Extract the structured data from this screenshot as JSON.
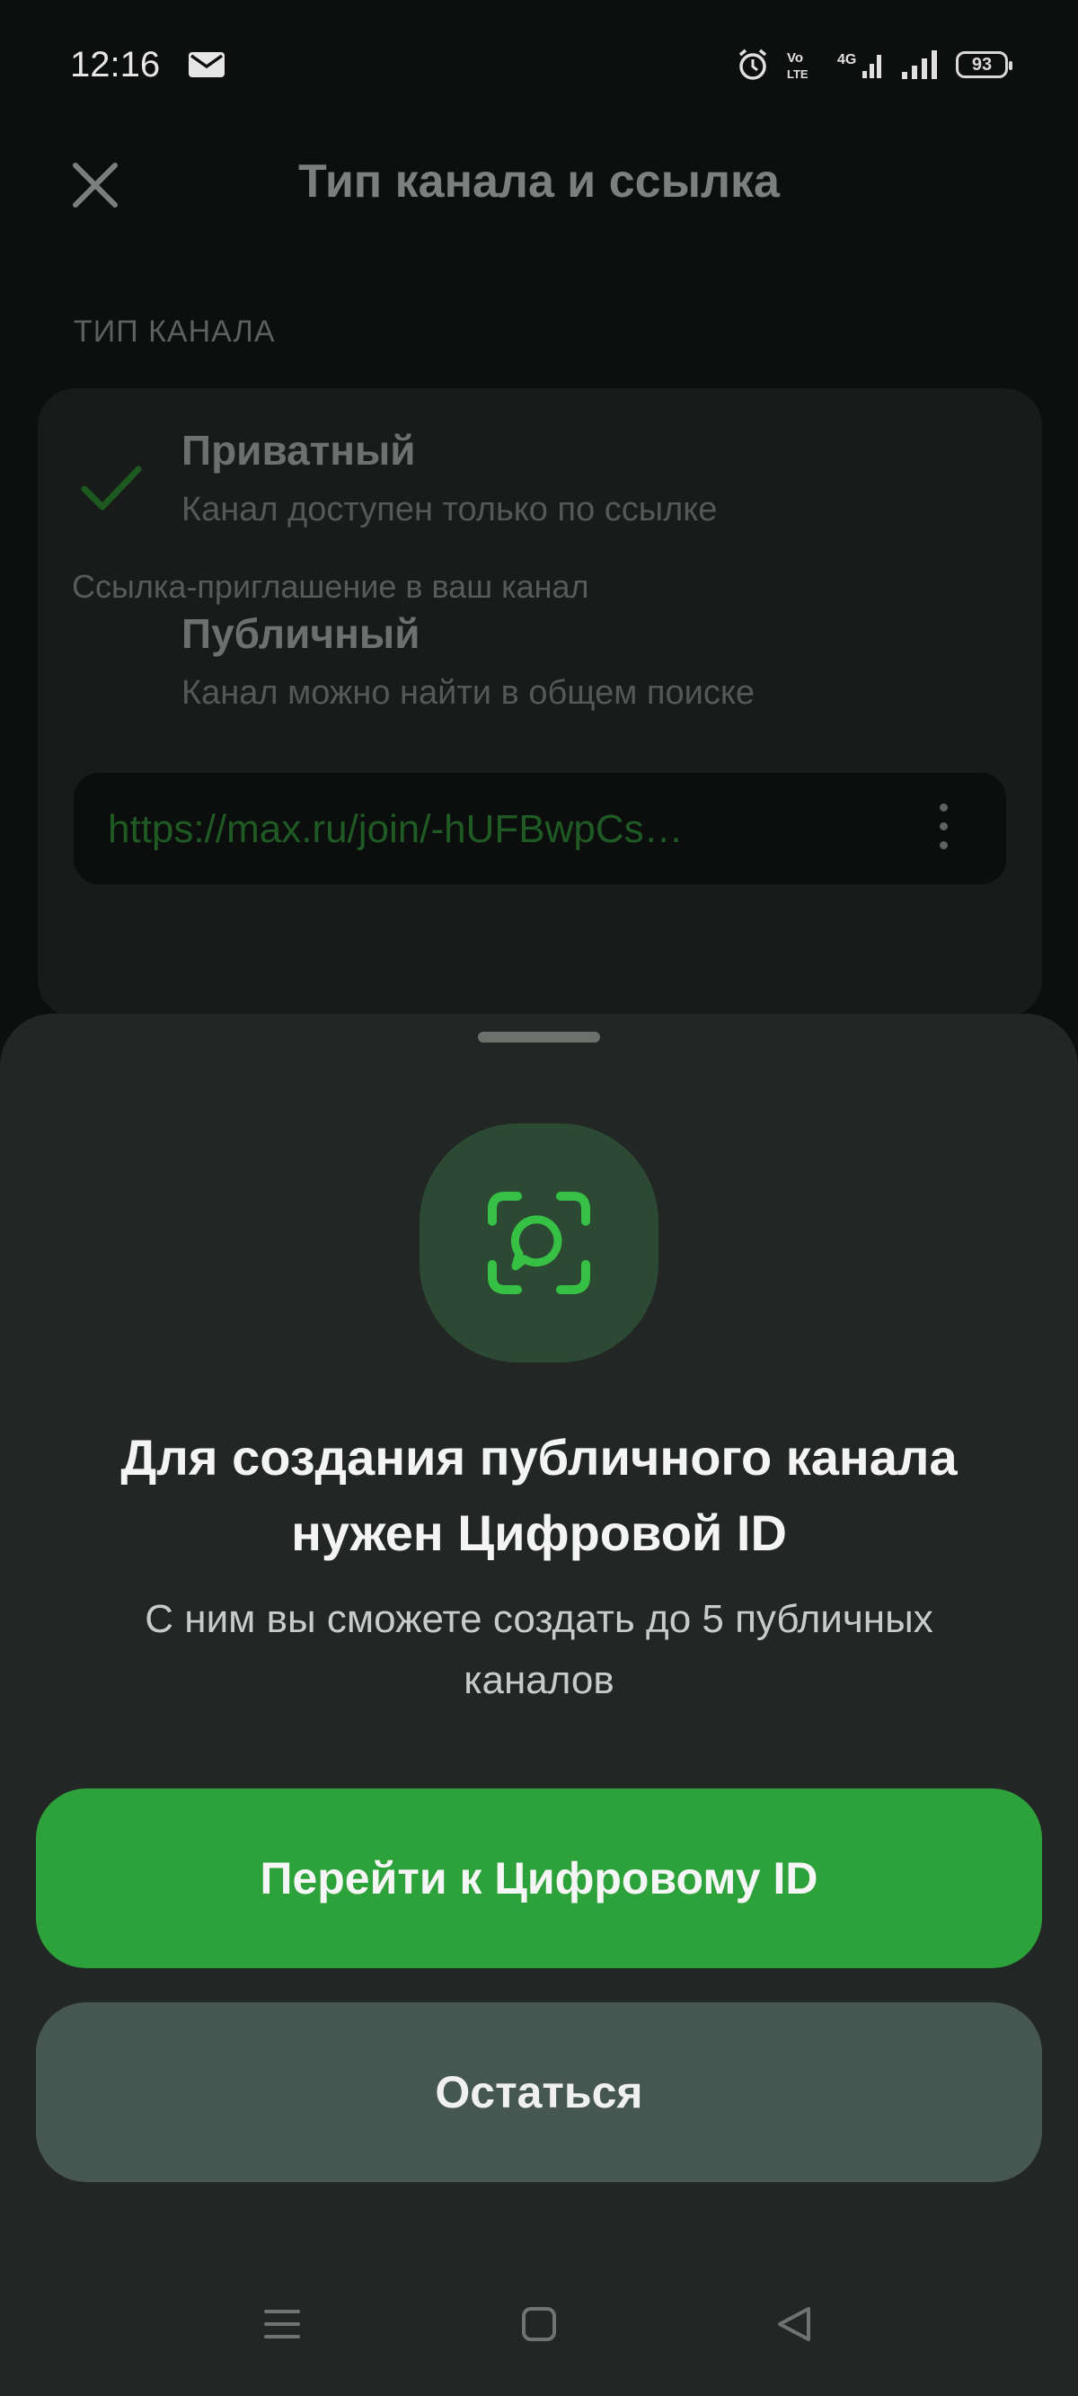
{
  "status_bar": {
    "time": "12:16",
    "battery": "93",
    "icons": [
      "mail-icon",
      "alarm-icon",
      "volte-icon",
      "4g-signal-icon",
      "signal-icon",
      "battery-icon"
    ]
  },
  "header": {
    "title": "Тип канала и ссылка",
    "close_icon": "close-icon"
  },
  "channel_type": {
    "section_label": "ТИП КАНАЛА",
    "options": [
      {
        "title": "Приватный",
        "description": "Канал доступен только по ссылке",
        "selected": true
      },
      {
        "title": "Публичный",
        "description": "Канал можно найти в общем поиске",
        "selected": false
      }
    ],
    "link": "https://max.ru/join/-hUFBwpCs…",
    "link_caption": "Ссылка-приглашение в ваш канал"
  },
  "sheet": {
    "icon": "digital-id-icon",
    "title": "Для создания публичного канала нужен Цифровой ID",
    "subtitle": "С ним вы сможете создать до 5 публичных каналов",
    "primary_button": "Перейти к Цифровому ID",
    "secondary_button": "Остаться"
  },
  "colors": {
    "accent": "#2ea23a",
    "sheet_bg": "#222725",
    "secondary_button": "#455750"
  }
}
